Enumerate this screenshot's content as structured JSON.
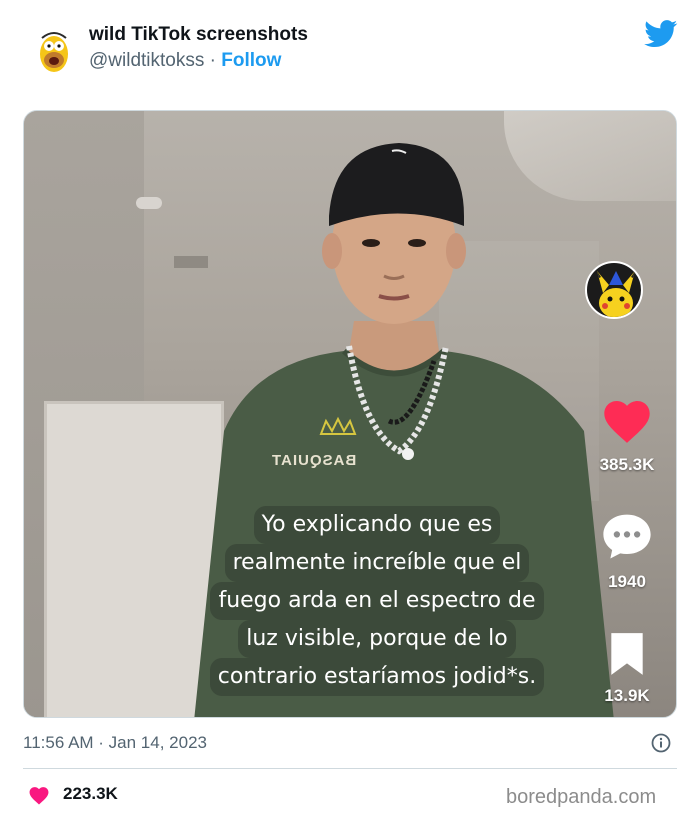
{
  "tweet": {
    "display_name": "wild TikTok screenshots",
    "handle": "@wildtiktokss",
    "separator": "·",
    "follow_label": "Follow",
    "timestamp": "11:56 AM · Jan 14, 2023",
    "likes": "223.3K"
  },
  "video": {
    "shirt_text": "BASQUIAT",
    "caption_lines": [
      "Yo explicando que es",
      "realmente increíble que el",
      "fuego arda en el espectro de",
      "luz visible, porque de lo",
      "contrario estaríamos jodid*s."
    ],
    "like_count": "385.3K",
    "comment_count": "1940",
    "save_count": "13.9K"
  },
  "watermark": "boredpanda.com",
  "colors": {
    "twitter_blue": "#1d9bf0",
    "like_red": "#f91880",
    "tiktok_heart": "#fe2c55",
    "caption_bg": "#3c4a3a",
    "shirt_green": "#4a5c46"
  }
}
